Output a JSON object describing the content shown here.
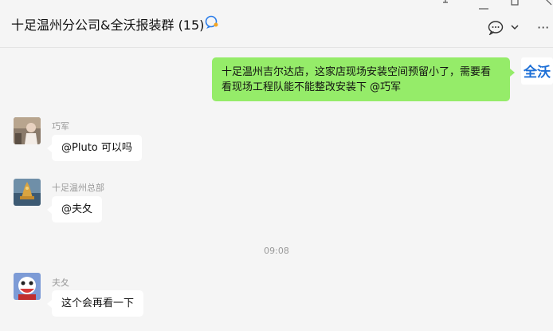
{
  "window": {
    "pin_icon": "pin-icon",
    "minimize_icon": "minimize-icon",
    "maximize_icon": "maximize-icon",
    "close_icon": "close-icon"
  },
  "header": {
    "title": "十足温州分公司&全沃报装群 (15)",
    "title_icon": "group-chat-badge-icon",
    "chat_icon": "chat-bubble-icon",
    "chevron_icon": "chevron-down-icon",
    "more_label": "···"
  },
  "messages": [
    {
      "side": "right",
      "text": "十足温州吉尔达店，这家店现场安装空间预留小了，需要看看现场工程队能不能整改安装下 @巧军",
      "avatar_text": "全沃"
    },
    {
      "side": "left",
      "sender": "巧军",
      "text": "@Pluto 可以吗"
    },
    {
      "side": "left",
      "sender": "十足温州总部",
      "text": "@夫夂"
    },
    {
      "type": "time",
      "text": "09:08"
    },
    {
      "side": "left",
      "sender": "夫夂",
      "text": "这个会再看一下"
    }
  ],
  "colors": {
    "background": "#f5f5f5",
    "self_bubble": "#95ec69",
    "other_bubble": "#ffffff",
    "muted_text": "#999999",
    "accent": "#1d6fd6"
  }
}
